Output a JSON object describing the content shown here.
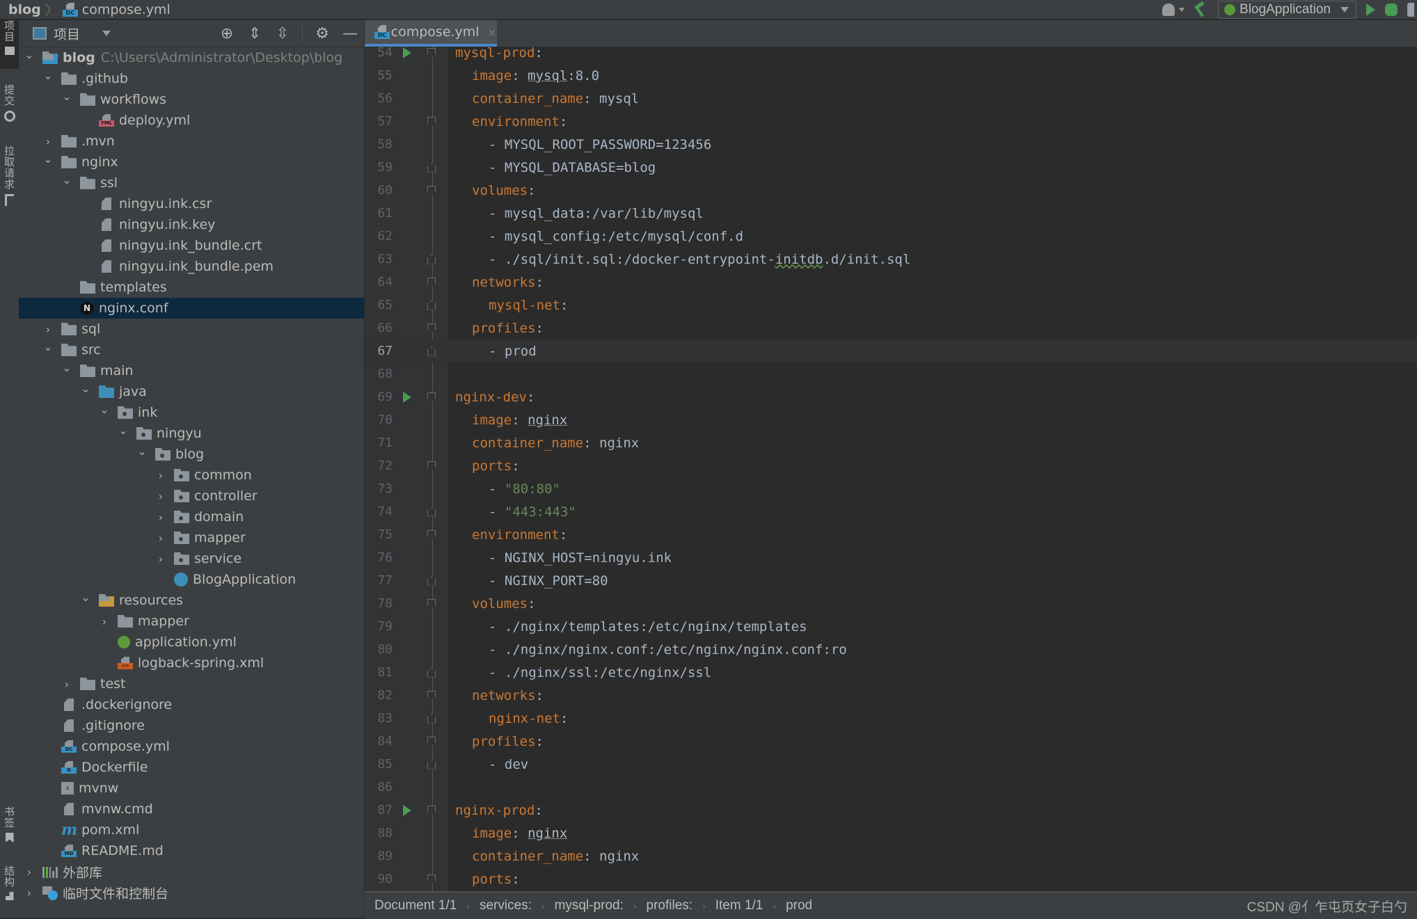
{
  "topbar": {
    "breadcrumb": [
      "blog",
      "compose.yml"
    ],
    "run_config": "BlogApplication",
    "icons": [
      "account-icon",
      "build-hammer-icon",
      "spring-boot-icon",
      "run-icon",
      "debug-icon",
      "coverage-icon"
    ]
  },
  "side_strip": {
    "items": [
      {
        "label": "项目",
        "icon": "folder-icon",
        "active": true
      },
      {
        "label": "提交",
        "icon": "commit-icon",
        "active": false
      },
      {
        "label": "拉取请求",
        "icon": "pull-request-icon",
        "active": false
      },
      {
        "label": "书签",
        "icon": "bookmark-icon",
        "active": false
      },
      {
        "label": "结构",
        "icon": "structure-icon",
        "active": false
      }
    ]
  },
  "project_panel": {
    "title": "项目",
    "tools": [
      "locate-icon",
      "expand-all-icon",
      "collapse-all-icon",
      "gear-icon",
      "hide-icon"
    ],
    "tree": [
      {
        "depth": 0,
        "chevron": "down",
        "icon": "project-folder",
        "label": "blog",
        "bold": true,
        "path": "C:\\Users\\Administrator\\Desktop\\blog"
      },
      {
        "depth": 1,
        "chevron": "down",
        "icon": "folder",
        "label": ".github"
      },
      {
        "depth": 2,
        "chevron": "down",
        "icon": "folder",
        "label": "workflows"
      },
      {
        "depth": 3,
        "chevron": "none",
        "icon": "yml",
        "label": "deploy.yml"
      },
      {
        "depth": 1,
        "chevron": "right",
        "icon": "folder",
        "label": ".mvn"
      },
      {
        "depth": 1,
        "chevron": "down",
        "icon": "folder",
        "label": "nginx"
      },
      {
        "depth": 2,
        "chevron": "down",
        "icon": "folder",
        "label": "ssl"
      },
      {
        "depth": 3,
        "chevron": "none",
        "icon": "text-file",
        "label": "ningyu.ink.csr"
      },
      {
        "depth": 3,
        "chevron": "none",
        "icon": "text-file",
        "label": "ningyu.ink.key"
      },
      {
        "depth": 3,
        "chevron": "none",
        "icon": "text-file",
        "label": "ningyu.ink_bundle.crt"
      },
      {
        "depth": 3,
        "chevron": "none",
        "icon": "text-file",
        "label": "ningyu.ink_bundle.pem"
      },
      {
        "depth": 2,
        "chevron": "none",
        "icon": "folder",
        "label": "templates"
      },
      {
        "depth": 2,
        "chevron": "none",
        "icon": "nginx",
        "label": "nginx.conf",
        "selected": true
      },
      {
        "depth": 1,
        "chevron": "right",
        "icon": "folder",
        "label": "sql"
      },
      {
        "depth": 1,
        "chevron": "down",
        "icon": "folder",
        "label": "src"
      },
      {
        "depth": 2,
        "chevron": "down",
        "icon": "folder",
        "label": "main"
      },
      {
        "depth": 3,
        "chevron": "down",
        "icon": "source-folder",
        "label": "java"
      },
      {
        "depth": 4,
        "chevron": "down",
        "icon": "package",
        "label": "ink"
      },
      {
        "depth": 5,
        "chevron": "down",
        "icon": "package",
        "label": "ningyu"
      },
      {
        "depth": 6,
        "chevron": "down",
        "icon": "package",
        "label": "blog"
      },
      {
        "depth": 7,
        "chevron": "right",
        "icon": "package",
        "label": "common"
      },
      {
        "depth": 7,
        "chevron": "right",
        "icon": "package",
        "label": "controller"
      },
      {
        "depth": 7,
        "chevron": "right",
        "icon": "package",
        "label": "domain"
      },
      {
        "depth": 7,
        "chevron": "right",
        "icon": "package",
        "label": "mapper"
      },
      {
        "depth": 7,
        "chevron": "right",
        "icon": "package",
        "label": "service"
      },
      {
        "depth": 7,
        "chevron": "none",
        "icon": "spring-app",
        "label": "BlogApplication"
      },
      {
        "depth": 3,
        "chevron": "down",
        "icon": "resources-folder",
        "label": "resources"
      },
      {
        "depth": 4,
        "chevron": "right",
        "icon": "folder",
        "label": "mapper"
      },
      {
        "depth": 4,
        "chevron": "none",
        "icon": "spring-yml",
        "label": "application.yml"
      },
      {
        "depth": 4,
        "chevron": "none",
        "icon": "xml",
        "label": "logback-spring.xml"
      },
      {
        "depth": 2,
        "chevron": "right",
        "icon": "folder",
        "label": "test"
      },
      {
        "depth": 1,
        "chevron": "none",
        "icon": "ignore-file",
        "label": ".dockerignore"
      },
      {
        "depth": 1,
        "chevron": "none",
        "icon": "ignore-file",
        "label": ".gitignore"
      },
      {
        "depth": 1,
        "chevron": "none",
        "icon": "docker-compose",
        "label": "compose.yml"
      },
      {
        "depth": 1,
        "chevron": "none",
        "icon": "dockerfile",
        "label": "Dockerfile"
      },
      {
        "depth": 1,
        "chevron": "none",
        "icon": "shell",
        "label": "mvnw"
      },
      {
        "depth": 1,
        "chevron": "none",
        "icon": "text-file",
        "label": "mvnw.cmd"
      },
      {
        "depth": 1,
        "chevron": "none",
        "icon": "maven",
        "label": "pom.xml"
      },
      {
        "depth": 1,
        "chevron": "none",
        "icon": "markdown",
        "label": "README.md"
      },
      {
        "depth": 0,
        "chevron": "right",
        "icon": "libraries",
        "label": "外部库"
      },
      {
        "depth": 0,
        "chevron": "right",
        "icon": "scratches",
        "label": "临时文件和控制台"
      }
    ]
  },
  "editor": {
    "tab": {
      "label": "compose.yml",
      "close": "×"
    },
    "current_line": 67,
    "lines": [
      {
        "n": 54,
        "run": true,
        "fold": "open",
        "indent": 0,
        "parts": [
          [
            "k",
            "mysql-prod"
          ],
          [
            "p",
            ":"
          ]
        ]
      },
      {
        "n": 55,
        "indent": 1,
        "parts": [
          [
            "k",
            "image"
          ],
          [
            "p",
            ": "
          ],
          [
            "u",
            "mysql"
          ],
          [
            "p",
            ":8.0"
          ]
        ]
      },
      {
        "n": 56,
        "indent": 1,
        "parts": [
          [
            "k",
            "container_name"
          ],
          [
            "p",
            ": mysql"
          ]
        ]
      },
      {
        "n": 57,
        "fold": "open",
        "indent": 1,
        "parts": [
          [
            "k",
            "environment"
          ],
          [
            "p",
            ":"
          ]
        ]
      },
      {
        "n": 58,
        "indent": 2,
        "parts": [
          [
            "p",
            "- MYSQL_ROOT_PASSWORD=123456"
          ]
        ]
      },
      {
        "n": 59,
        "fold": "end",
        "indent": 2,
        "parts": [
          [
            "p",
            "- MYSQL_DATABASE=blog"
          ]
        ]
      },
      {
        "n": 60,
        "fold": "open",
        "indent": 1,
        "parts": [
          [
            "k",
            "volumes"
          ],
          [
            "p",
            ":"
          ]
        ]
      },
      {
        "n": 61,
        "indent": 2,
        "parts": [
          [
            "p",
            "- mysql_data:/var/lib/mysql"
          ]
        ]
      },
      {
        "n": 62,
        "indent": 2,
        "parts": [
          [
            "p",
            "- mysql_config:/etc/mysql/conf.d"
          ]
        ]
      },
      {
        "n": 63,
        "fold": "end",
        "indent": 2,
        "parts": [
          [
            "p",
            "- ./sql/init.sql:/docker-entrypoint-"
          ],
          [
            "w",
            "initdb"
          ],
          [
            "p",
            ".d/init.sql"
          ]
        ]
      },
      {
        "n": 64,
        "fold": "open",
        "indent": 1,
        "parts": [
          [
            "k",
            "networks"
          ],
          [
            "p",
            ":"
          ]
        ]
      },
      {
        "n": 65,
        "fold": "end",
        "indent": 2,
        "parts": [
          [
            "k",
            "mysql-net"
          ],
          [
            "p",
            ":"
          ]
        ]
      },
      {
        "n": 66,
        "fold": "open",
        "indent": 1,
        "parts": [
          [
            "k",
            "profiles"
          ],
          [
            "p",
            ":"
          ]
        ]
      },
      {
        "n": 67,
        "fold": "end",
        "indent": 2,
        "parts": [
          [
            "p",
            "- prod"
          ]
        ]
      },
      {
        "n": 68,
        "indent": 0,
        "parts": []
      },
      {
        "n": 69,
        "run": true,
        "fold": "open",
        "indent": 0,
        "parts": [
          [
            "k",
            "nginx-dev"
          ],
          [
            "p",
            ":"
          ]
        ]
      },
      {
        "n": 70,
        "indent": 1,
        "parts": [
          [
            "k",
            "image"
          ],
          [
            "p",
            ": "
          ],
          [
            "u",
            "nginx"
          ]
        ]
      },
      {
        "n": 71,
        "indent": 1,
        "parts": [
          [
            "k",
            "container_name"
          ],
          [
            "p",
            ": nginx"
          ]
        ]
      },
      {
        "n": 72,
        "fold": "open",
        "indent": 1,
        "parts": [
          [
            "k",
            "ports"
          ],
          [
            "p",
            ":"
          ]
        ]
      },
      {
        "n": 73,
        "indent": 2,
        "parts": [
          [
            "p",
            "- "
          ],
          [
            "s",
            "\"80:80\""
          ]
        ]
      },
      {
        "n": 74,
        "fold": "end",
        "indent": 2,
        "parts": [
          [
            "p",
            "- "
          ],
          [
            "s",
            "\"443:443\""
          ]
        ]
      },
      {
        "n": 75,
        "fold": "open",
        "indent": 1,
        "parts": [
          [
            "k",
            "environment"
          ],
          [
            "p",
            ":"
          ]
        ]
      },
      {
        "n": 76,
        "indent": 2,
        "parts": [
          [
            "p",
            "- NGINX_HOST=ningyu.ink"
          ]
        ]
      },
      {
        "n": 77,
        "fold": "end",
        "indent": 2,
        "parts": [
          [
            "p",
            "- NGINX_PORT=80"
          ]
        ]
      },
      {
        "n": 78,
        "fold": "open",
        "indent": 1,
        "parts": [
          [
            "k",
            "volumes"
          ],
          [
            "p",
            ":"
          ]
        ]
      },
      {
        "n": 79,
        "indent": 2,
        "parts": [
          [
            "p",
            "- ./nginx/templates:/etc/nginx/templates"
          ]
        ]
      },
      {
        "n": 80,
        "indent": 2,
        "parts": [
          [
            "p",
            "- ./nginx/nginx.conf:/etc/nginx/nginx.conf:ro"
          ]
        ]
      },
      {
        "n": 81,
        "fold": "end",
        "indent": 2,
        "parts": [
          [
            "p",
            "- ./nginx/ssl:/etc/nginx/ssl"
          ]
        ]
      },
      {
        "n": 82,
        "fold": "open",
        "indent": 1,
        "parts": [
          [
            "k",
            "networks"
          ],
          [
            "p",
            ":"
          ]
        ]
      },
      {
        "n": 83,
        "fold": "end",
        "indent": 2,
        "parts": [
          [
            "k",
            "nginx-net"
          ],
          [
            "p",
            ":"
          ]
        ]
      },
      {
        "n": 84,
        "fold": "open",
        "indent": 1,
        "parts": [
          [
            "k",
            "profiles"
          ],
          [
            "p",
            ":"
          ]
        ]
      },
      {
        "n": 85,
        "fold": "end",
        "indent": 2,
        "parts": [
          [
            "p",
            "- dev"
          ]
        ]
      },
      {
        "n": 86,
        "indent": 0,
        "parts": []
      },
      {
        "n": 87,
        "run": true,
        "fold": "open",
        "indent": 0,
        "parts": [
          [
            "k",
            "nginx-prod"
          ],
          [
            "p",
            ":"
          ]
        ]
      },
      {
        "n": 88,
        "indent": 1,
        "parts": [
          [
            "k",
            "image"
          ],
          [
            "p",
            ": "
          ],
          [
            "u",
            "nginx"
          ]
        ]
      },
      {
        "n": 89,
        "indent": 1,
        "parts": [
          [
            "k",
            "container_name"
          ],
          [
            "p",
            ": nginx"
          ]
        ]
      },
      {
        "n": 90,
        "fold": "open",
        "indent": 1,
        "parts": [
          [
            "k",
            "ports"
          ],
          [
            "p",
            ":"
          ]
        ]
      }
    ]
  },
  "statusbar": {
    "breadcrumbs": [
      "Document 1/1",
      "services:",
      "mysql-prod:",
      "profiles:",
      "Item 1/1",
      "prod"
    ],
    "watermark": "CSDN @亻乍屯页女子白勺"
  },
  "colors": {
    "keyword": "#cc7832",
    "string": "#6a8759",
    "plain": "#a9b7c6",
    "selection": "#0d293e",
    "tab_accent": "#4a88c7",
    "run_green": "#499c54"
  }
}
